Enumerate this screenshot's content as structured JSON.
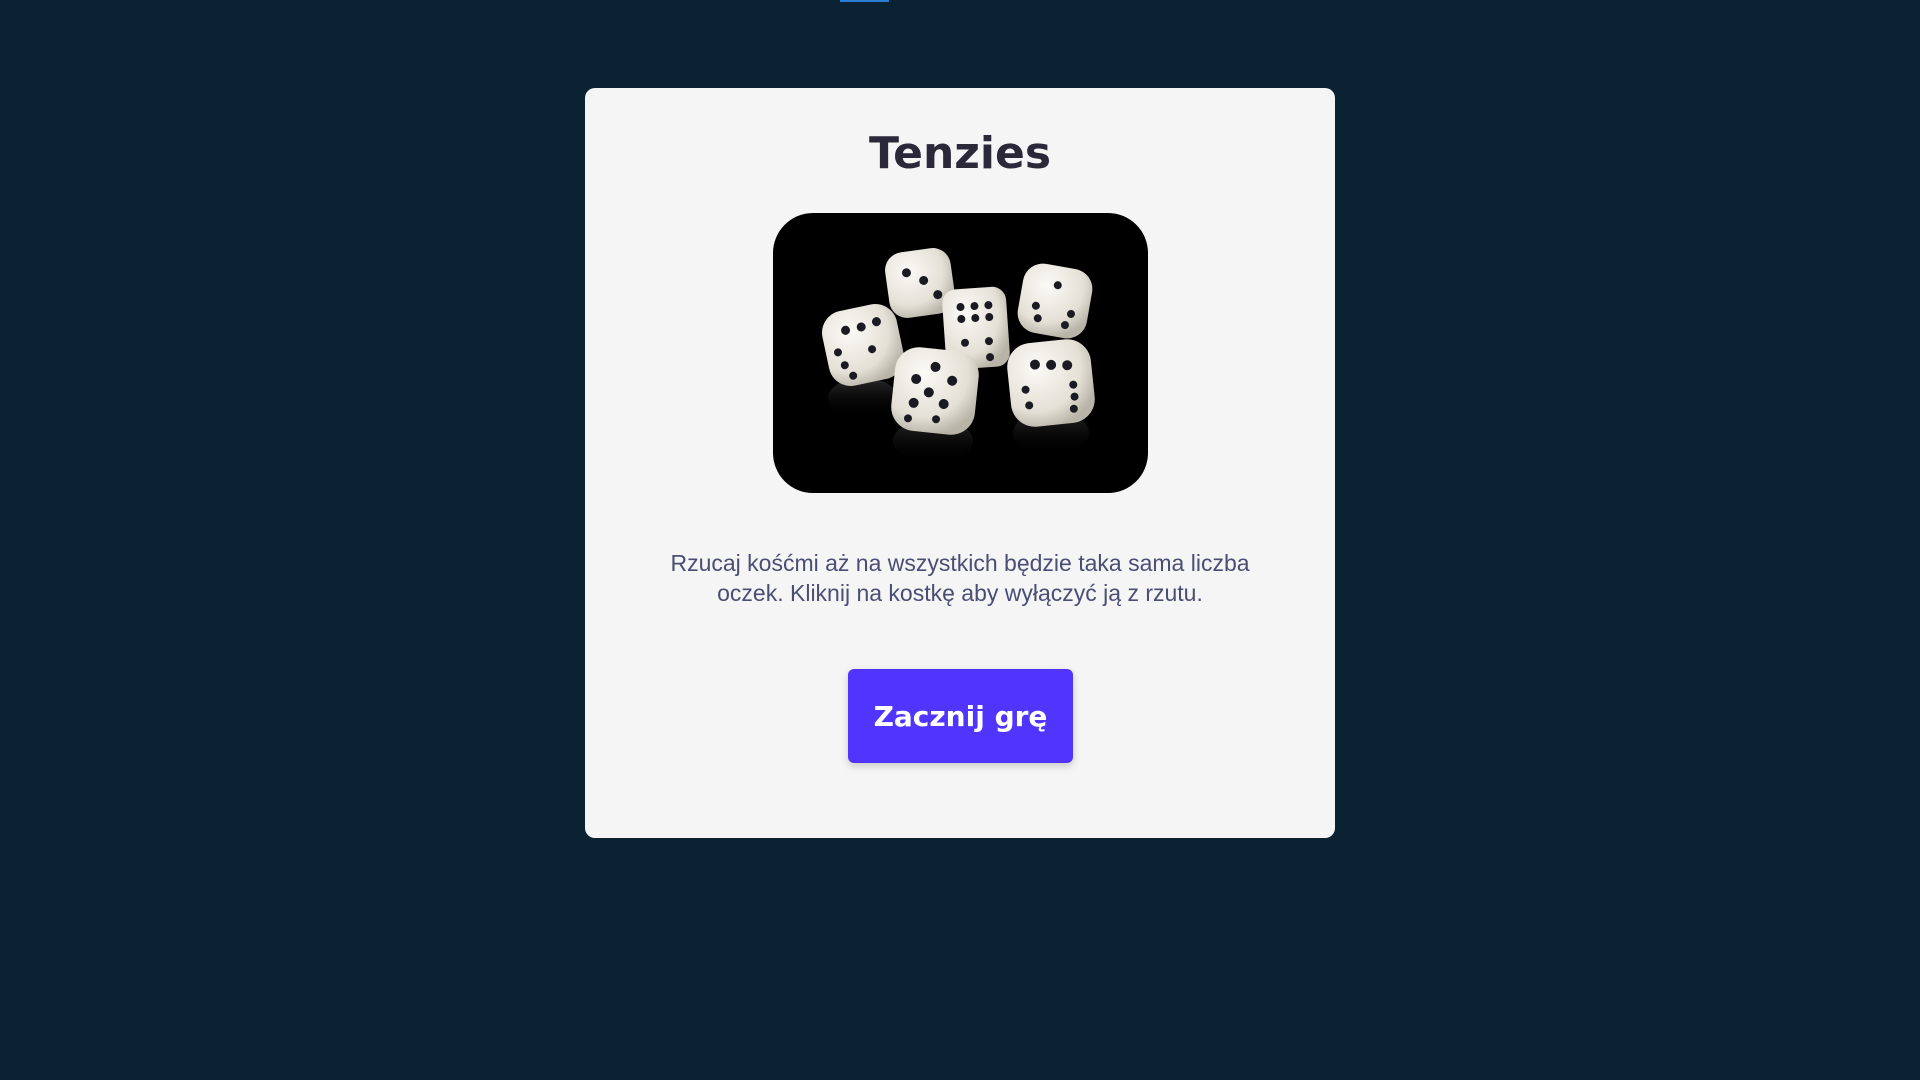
{
  "colors": {
    "background": "#0b2233",
    "card": "#f5f5f5",
    "title": "#2b283a",
    "text": "#4a4e74",
    "button": "#5035ff",
    "button_text": "#ffffff"
  },
  "game": {
    "title": "Tenzies",
    "description": "Rzucaj kośćmi aż na wszystkich będzie taka sama liczba oczek. Kliknij na kostkę aby wyłączyć ją z rzutu.",
    "start_label": "Zacznij grę",
    "image_icon": "dice-photo-icon"
  }
}
